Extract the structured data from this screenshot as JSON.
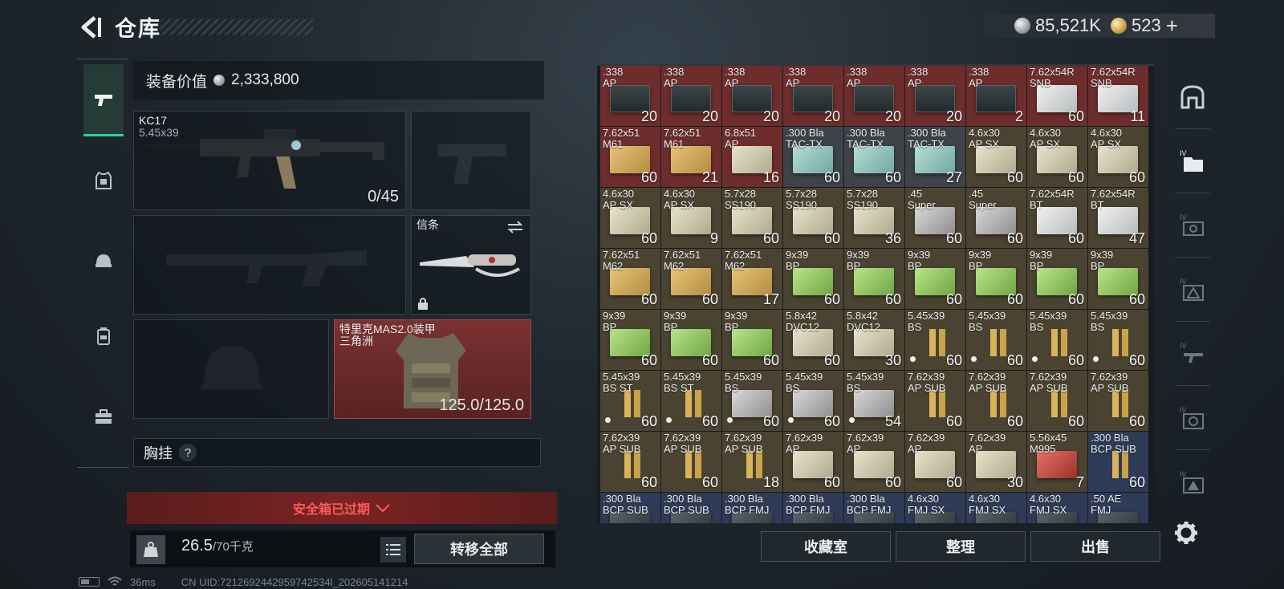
{
  "header": {
    "title": "仓库"
  },
  "currency": {
    "coins": "85,521K",
    "premium": "523"
  },
  "categories": [
    "weapons",
    "armor",
    "backpack",
    "chest-rig",
    "toolbox"
  ],
  "equipment": {
    "value_label": "装备价值",
    "value": "2,333,800",
    "primary": {
      "name": "KC17",
      "ammo": "5.45x39",
      "count": "0/45"
    },
    "melee": {
      "name": "信条"
    },
    "armor": {
      "name": "特里克MAS2.0装甲",
      "sub": "三角洲",
      "durability": "125.0/125.0"
    },
    "chest_rig_label": "胸挂",
    "help": "?",
    "safe_box_expired": "安全箱已过期"
  },
  "weight": {
    "current": "26.5",
    "max": "/70千克"
  },
  "buttons": {
    "transfer_all": "转移全部",
    "collection": "收藏室",
    "organize": "整理",
    "sell": "出售"
  },
  "status": {
    "ping": "36ms",
    "uid": "CN UID:7212692442959742534l_202605141214"
  },
  "inventory": [
    {
      "l1": ".338",
      "l2": "AP",
      "qty": "20",
      "art": "crate",
      "bg": "red"
    },
    {
      "l1": ".338",
      "l2": "AP",
      "qty": "20",
      "art": "crate",
      "bg": "red"
    },
    {
      "l1": ".338",
      "l2": "AP",
      "qty": "20",
      "art": "crate",
      "bg": "red"
    },
    {
      "l1": ".338",
      "l2": "AP",
      "qty": "20",
      "art": "crate",
      "bg": "red"
    },
    {
      "l1": ".338",
      "l2": "AP",
      "qty": "20",
      "art": "crate",
      "bg": "red"
    },
    {
      "l1": ".338",
      "l2": "AP",
      "qty": "20",
      "art": "crate",
      "bg": "red"
    },
    {
      "l1": ".338",
      "l2": "AP",
      "qty": "2",
      "art": "crate",
      "bg": "red"
    },
    {
      "l1": "7.62x54R",
      "l2": "SNB",
      "qty": "60",
      "art": "white",
      "bg": "red"
    },
    {
      "l1": "7.62x54R",
      "l2": "SNB",
      "qty": "11",
      "art": "white",
      "bg": "red"
    },
    {
      "l1": "7.62x51",
      "l2": "M61",
      "qty": "60",
      "art": "tan",
      "bg": "red"
    },
    {
      "l1": "7.62x51",
      "l2": "M61",
      "qty": "21",
      "art": "tan",
      "bg": "red"
    },
    {
      "l1": "6.8x51",
      "l2": "AP",
      "qty": "16",
      "art": "cream",
      "bg": "red"
    },
    {
      "l1": ".300 Bla",
      "l2": "TAC-TX",
      "qty": "60",
      "art": "teal",
      "bg": "gray"
    },
    {
      "l1": ".300 Bla",
      "l2": "TAC-TX",
      "qty": "60",
      "art": "teal",
      "bg": "gray"
    },
    {
      "l1": ".300 Bla",
      "l2": "TAC-TX",
      "qty": "27",
      "art": "teal",
      "bg": "gray"
    },
    {
      "l1": "4.6x30",
      "l2": "AP SX",
      "qty": "60",
      "art": "cream",
      "bg": "brown"
    },
    {
      "l1": "4.6x30",
      "l2": "AP SX",
      "qty": "60",
      "art": "cream",
      "bg": "brown"
    },
    {
      "l1": "4.6x30",
      "l2": "AP SX",
      "qty": "60",
      "art": "cream",
      "bg": "brown"
    },
    {
      "l1": "4.6x30",
      "l2": "AP SX",
      "qty": "60",
      "art": "cream",
      "bg": "brown"
    },
    {
      "l1": "4.6x30",
      "l2": "AP SX",
      "qty": "9",
      "art": "cream",
      "bg": "brown"
    },
    {
      "l1": "5.7x28",
      "l2": "SS190",
      "qty": "60",
      "art": "cream",
      "bg": "brown"
    },
    {
      "l1": "5.7x28",
      "l2": "SS190",
      "qty": "60",
      "art": "cream",
      "bg": "brown"
    },
    {
      "l1": "5.7x28",
      "l2": "SS190",
      "qty": "36",
      "art": "cream",
      "bg": "brown"
    },
    {
      "l1": ".45",
      "l2": "Super",
      "qty": "60",
      "art": "silver",
      "bg": "brown"
    },
    {
      "l1": ".45",
      "l2": "Super",
      "qty": "60",
      "art": "silver",
      "bg": "brown"
    },
    {
      "l1": "7.62x54R",
      "l2": "BT",
      "qty": "60",
      "art": "white",
      "bg": "brown"
    },
    {
      "l1": "7.62x54R",
      "l2": "BT",
      "qty": "47",
      "art": "white",
      "bg": "brown"
    },
    {
      "l1": "7.62x51",
      "l2": "M62",
      "qty": "60",
      "art": "tan",
      "bg": "brown"
    },
    {
      "l1": "7.62x51",
      "l2": "M62",
      "qty": "60",
      "art": "tan",
      "bg": "brown"
    },
    {
      "l1": "7.62x51",
      "l2": "M62",
      "qty": "17",
      "art": "tan",
      "bg": "brown"
    },
    {
      "l1": "9x39",
      "l2": "BP",
      "qty": "60",
      "art": "green",
      "bg": "brown"
    },
    {
      "l1": "9x39",
      "l2": "BP",
      "qty": "60",
      "art": "green",
      "bg": "brown"
    },
    {
      "l1": "9x39",
      "l2": "BP",
      "qty": "60",
      "art": "green",
      "bg": "brown"
    },
    {
      "l1": "9x39",
      "l2": "BP",
      "qty": "60",
      "art": "green",
      "bg": "brown"
    },
    {
      "l1": "9x39",
      "l2": "BP",
      "qty": "60",
      "art": "green",
      "bg": "brown"
    },
    {
      "l1": "9x39",
      "l2": "BP",
      "qty": "60",
      "art": "green",
      "bg": "brown"
    },
    {
      "l1": "9x39",
      "l2": "BP",
      "qty": "60",
      "art": "green",
      "bg": "brown"
    },
    {
      "l1": "9x39",
      "l2": "BP",
      "qty": "60",
      "art": "green",
      "bg": "brown"
    },
    {
      "l1": "9x39",
      "l2": "BP",
      "qty": "60",
      "art": "green",
      "bg": "brown"
    },
    {
      "l1": "5.8x42",
      "l2": "DVC12",
      "qty": "60",
      "art": "cream",
      "bg": "brown"
    },
    {
      "l1": "5.8x42",
      "l2": "DVC12",
      "qty": "30",
      "art": "cream",
      "bg": "brown"
    },
    {
      "l1": "5.45x39",
      "l2": "BS",
      "qty": "60",
      "art": "bullet",
      "bg": "brown",
      "dot": true
    },
    {
      "l1": "5.45x39",
      "l2": "BS",
      "qty": "60",
      "art": "bullet",
      "bg": "brown",
      "dot": true
    },
    {
      "l1": "5.45x39",
      "l2": "BS",
      "qty": "60",
      "art": "bullet",
      "bg": "brown",
      "dot": true
    },
    {
      "l1": "5.45x39",
      "l2": "BS",
      "qty": "60",
      "art": "bullet",
      "bg": "brown",
      "dot": true
    },
    {
      "l1": "5.45x39",
      "l2": "BS ST",
      "qty": "60",
      "art": "bullet",
      "bg": "brown",
      "dot": true
    },
    {
      "l1": "5.45x39",
      "l2": "BS ST",
      "qty": "60",
      "art": "bullet",
      "bg": "brown",
      "dot": true
    },
    {
      "l1": "5.45x39",
      "l2": "BS",
      "qty": "60",
      "art": "silver",
      "bg": "brown",
      "dot": true
    },
    {
      "l1": "5.45x39",
      "l2": "BS",
      "qty": "60",
      "art": "silver",
      "bg": "brown",
      "dot": true
    },
    {
      "l1": "5.45x39",
      "l2": "BS",
      "qty": "54",
      "art": "silver",
      "bg": "brown",
      "dot": true
    },
    {
      "l1": "7.62x39",
      "l2": "AP SUB",
      "qty": "60",
      "art": "bullet",
      "bg": "brown"
    },
    {
      "l1": "7.62x39",
      "l2": "AP SUB",
      "qty": "60",
      "art": "bullet",
      "bg": "brown"
    },
    {
      "l1": "7.62x39",
      "l2": "AP SUB",
      "qty": "60",
      "art": "bullet",
      "bg": "brown"
    },
    {
      "l1": "7.62x39",
      "l2": "AP SUB",
      "qty": "60",
      "art": "bullet",
      "bg": "brown"
    },
    {
      "l1": "7.62x39",
      "l2": "AP SUB",
      "qty": "60",
      "art": "bullet",
      "bg": "brown"
    },
    {
      "l1": "7.62x39",
      "l2": "AP SUB",
      "qty": "60",
      "art": "bullet",
      "bg": "brown"
    },
    {
      "l1": "7.62x39",
      "l2": "AP SUB",
      "qty": "18",
      "art": "bullet",
      "bg": "brown"
    },
    {
      "l1": "7.62x39",
      "l2": "AP",
      "qty": "60",
      "art": "cream",
      "bg": "brown"
    },
    {
      "l1": "7.62x39",
      "l2": "AP",
      "qty": "60",
      "art": "cream",
      "bg": "brown"
    },
    {
      "l1": "7.62x39",
      "l2": "AP",
      "qty": "60",
      "art": "cream",
      "bg": "brown"
    },
    {
      "l1": "7.62x39",
      "l2": "AP",
      "qty": "30",
      "art": "cream",
      "bg": "brown"
    },
    {
      "l1": "5.56x45",
      "l2": "M995",
      "qty": "7",
      "art": "redbox",
      "bg": "brown"
    },
    {
      "l1": ".300 Bla",
      "l2": "BCP SUB",
      "qty": "60",
      "art": "bullet",
      "bg": "navy"
    },
    {
      "l1": ".300 Bla",
      "l2": "BCP SUB",
      "qty": "",
      "art": "dark",
      "bg": "navy"
    },
    {
      "l1": ".300 Bla",
      "l2": "BCP SUB",
      "qty": "",
      "art": "dark",
      "bg": "navy"
    },
    {
      "l1": ".300 Bla",
      "l2": "BCP FMJ",
      "qty": "",
      "art": "dark",
      "bg": "navy"
    },
    {
      "l1": ".300 Bla",
      "l2": "BCP FMJ",
      "qty": "",
      "art": "dark",
      "bg": "navy"
    },
    {
      "l1": ".300 Bla",
      "l2": "BCP FMJ",
      "qty": "",
      "art": "dark",
      "bg": "navy"
    },
    {
      "l1": "4.6x30",
      "l2": "FMJ SX",
      "qty": "",
      "art": "dark",
      "bg": "navy"
    },
    {
      "l1": "4.6x30",
      "l2": "FMJ SX",
      "qty": "",
      "art": "dark",
      "bg": "navy"
    },
    {
      "l1": "4.6x30",
      "l2": "FMJ SX",
      "qty": "",
      "art": "dark",
      "bg": "navy"
    },
    {
      "l1": ".50 AE",
      "l2": "FMJ",
      "qty": "",
      "art": "dark",
      "bg": "navy"
    }
  ]
}
